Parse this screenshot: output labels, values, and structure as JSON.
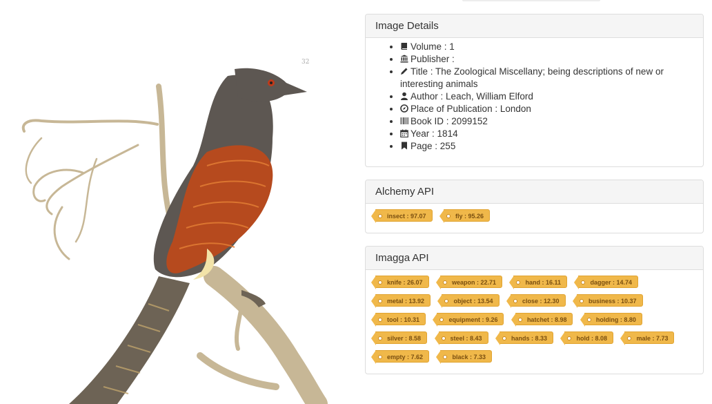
{
  "details": {
    "title": "Image Details",
    "items": [
      {
        "icon": "book-icon",
        "label": "Volume",
        "value": "1"
      },
      {
        "icon": "bank-icon",
        "label": "Publisher",
        "value": ""
      },
      {
        "icon": "pencil-icon",
        "label": "Title",
        "value": "The Zoological Miscellany; being descriptions of new or interesting animals"
      },
      {
        "icon": "user-icon",
        "label": "Author",
        "value": "Leach, William Elford"
      },
      {
        "icon": "compass-icon",
        "label": "Place of Publication",
        "value": "London"
      },
      {
        "icon": "barcode-icon",
        "label": "Book ID",
        "value": "2099152"
      },
      {
        "icon": "calendar-icon",
        "label": "Year",
        "value": "1814"
      },
      {
        "icon": "bookmark-icon",
        "label": "Page",
        "value": "255"
      }
    ]
  },
  "alchemy": {
    "title": "Alchemy API",
    "tags": [
      "insect : 97.07",
      "fly : 95.26"
    ]
  },
  "imagga": {
    "title": "Imagga API",
    "tags": [
      "knife : 26.07",
      "weapon : 22.71",
      "hand : 16.11",
      "dagger : 14.74",
      "metal : 13.92",
      "object : 13.54",
      "close : 12.30",
      "business : 10.37",
      "tool : 10.31",
      "equipment : 9.26",
      "hatchet : 8.98",
      "holding : 8.80",
      "silver : 8.58",
      "steel : 8.43",
      "hands : 8.33",
      "hold : 8.08",
      "male : 7.73",
      "empty : 7.62",
      "black : 7.33"
    ]
  },
  "colors": {
    "tag": "#f0b84a",
    "tag_text": "#7a4f10",
    "bird_head": "#5d5752",
    "bird_wing": "#b64a1e"
  }
}
